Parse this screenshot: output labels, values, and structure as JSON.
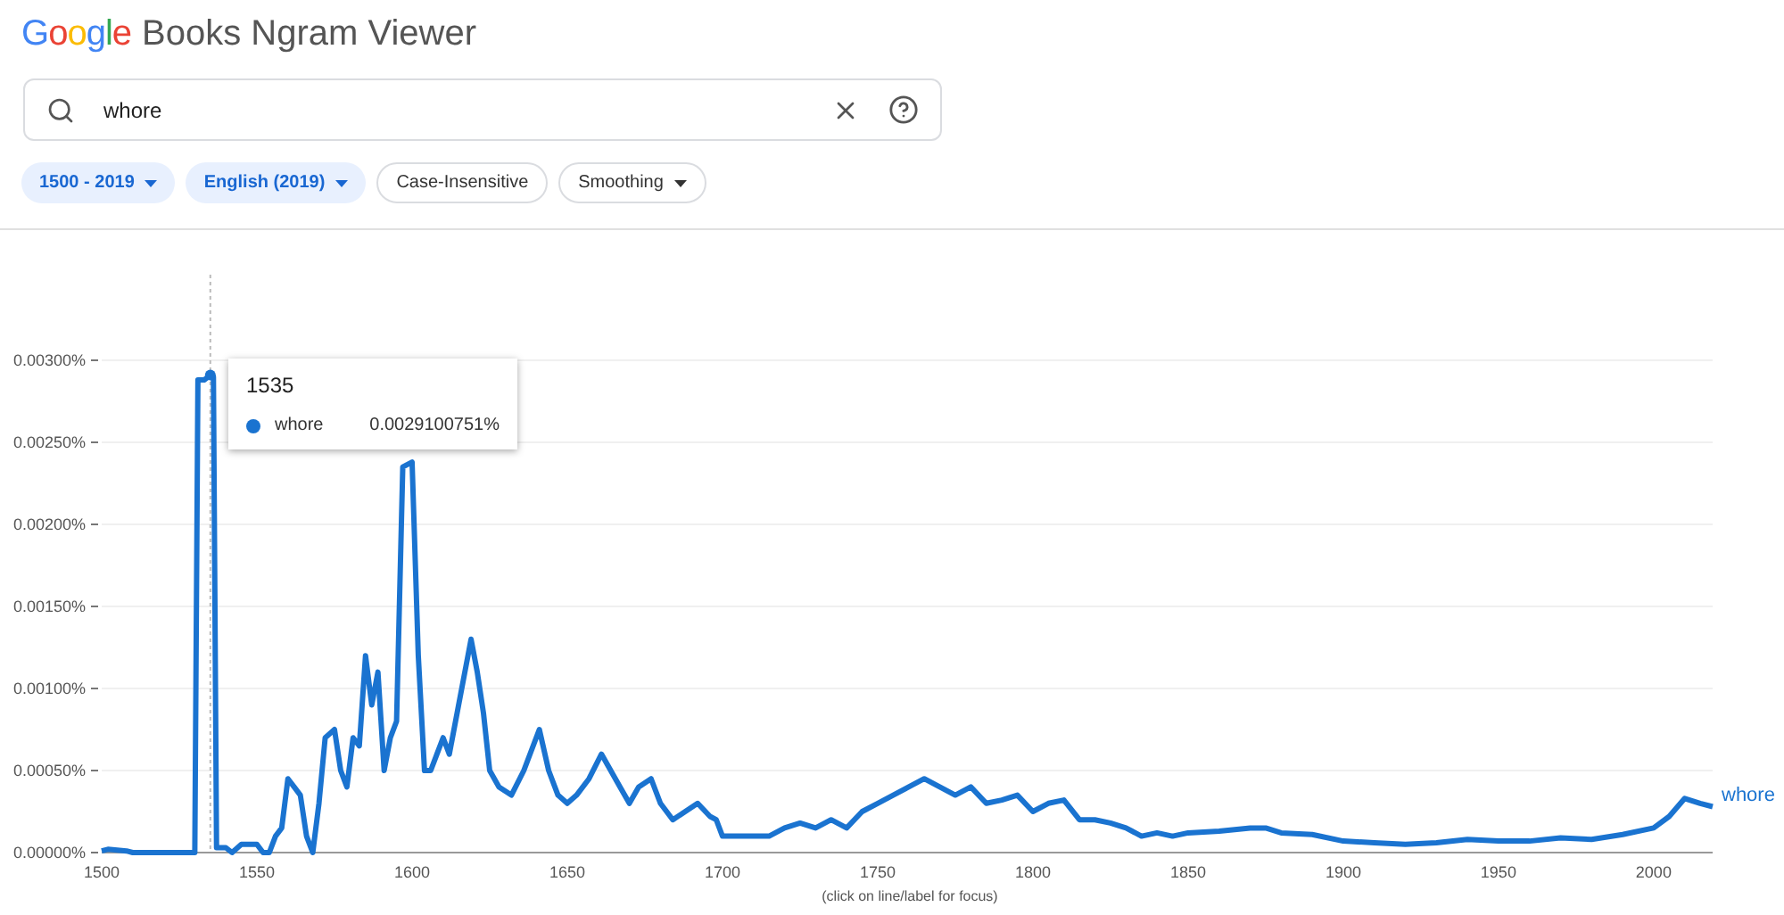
{
  "header": {
    "logo": "Google",
    "title": "Books Ngram Viewer"
  },
  "search": {
    "value": "whore"
  },
  "chips": [
    {
      "label": "1500 - 2019",
      "selected": true,
      "dropdown": true
    },
    {
      "label": "English (2019)",
      "selected": true,
      "dropdown": true
    },
    {
      "label": "Case-Insensitive",
      "selected": false,
      "dropdown": false
    },
    {
      "label": "Smoothing",
      "selected": false,
      "dropdown": true
    }
  ],
  "chart": {
    "tooltip": {
      "year": "1535",
      "series": "whore",
      "value": "0.0029100751%"
    },
    "caption": "(click on line/label for focus)",
    "chart_data": {
      "type": "line",
      "grid": true,
      "ref_lines": [
        {
          "axis": "x",
          "value": 1535
        }
      ],
      "xlim": [
        1500,
        2019
      ],
      "ylim": [
        0,
        0.0035
      ],
      "xticks": [
        1500,
        1550,
        1600,
        1650,
        1700,
        1750,
        1800,
        1850,
        1900,
        1950,
        2000
      ],
      "yticks": [
        {
          "value": 0,
          "label": "0.00000%"
        },
        {
          "value": 0.0005,
          "label": "0.00050%"
        },
        {
          "value": 0.001,
          "label": "0.00100%"
        },
        {
          "value": 0.0015,
          "label": "0.00150%"
        },
        {
          "value": 0.002,
          "label": "0.00200%"
        },
        {
          "value": 0.0025,
          "label": "0.00250%"
        },
        {
          "value": 0.003,
          "label": "0.00300%"
        }
      ],
      "x": [
        1500,
        1502,
        1508,
        1510,
        1530,
        1531,
        1533,
        1535,
        1536,
        1537,
        1540,
        1542,
        1545,
        1550,
        1552,
        1554,
        1556,
        1558,
        1560,
        1562,
        1564,
        1566,
        1568,
        1570,
        1572,
        1575,
        1577,
        1579,
        1581,
        1583,
        1585,
        1587,
        1589,
        1591,
        1593,
        1595,
        1597,
        1600,
        1602,
        1604,
        1606,
        1608,
        1610,
        1612,
        1615,
        1618,
        1619,
        1621,
        1623,
        1625,
        1628,
        1632,
        1636,
        1641,
        1644,
        1647,
        1650,
        1653,
        1657,
        1661,
        1664,
        1667,
        1670,
        1673,
        1677,
        1680,
        1684,
        1688,
        1692,
        1696,
        1698,
        1700,
        1705,
        1710,
        1715,
        1720,
        1725,
        1730,
        1735,
        1740,
        1745,
        1750,
        1755,
        1760,
        1765,
        1770,
        1775,
        1780,
        1785,
        1790,
        1795,
        1800,
        1805,
        1810,
        1815,
        1820,
        1825,
        1830,
        1835,
        1840,
        1845,
        1850,
        1860,
        1870,
        1875,
        1880,
        1890,
        1900,
        1910,
        1920,
        1930,
        1940,
        1950,
        1960,
        1970,
        1980,
        1990,
        2000,
        2005,
        2010,
        2015,
        2019
      ],
      "series": [
        {
          "name": "whore",
          "color": "#1a73d0",
          "values": [
            1e-05,
            2e-05,
            1e-05,
            0,
            0,
            0.00288,
            0.00288,
            0.00291,
            0.0029,
            3e-05,
            3e-05,
            0,
            5e-05,
            5e-05,
            0,
            0,
            0.0001,
            0.00015,
            0.00045,
            0.0004,
            0.00035,
            0.0001,
            0,
            0.0003,
            0.0007,
            0.00075,
            0.0005,
            0.0004,
            0.0007,
            0.00065,
            0.0012,
            0.0009,
            0.0011,
            0.0005,
            0.0007,
            0.0008,
            0.00235,
            0.00238,
            0.0012,
            0.0005,
            0.0005,
            0.0006,
            0.0007,
            0.0006,
            0.0009,
            0.0012,
            0.0013,
            0.0011,
            0.00085,
            0.0005,
            0.0004,
            0.00035,
            0.0005,
            0.00075,
            0.0005,
            0.00035,
            0.0003,
            0.00035,
            0.00045,
            0.0006,
            0.0005,
            0.0004,
            0.0003,
            0.0004,
            0.00045,
            0.0003,
            0.0002,
            0.00025,
            0.0003,
            0.00022,
            0.0002,
            0.0001,
            0.0001,
            0.0001,
            0.0001,
            0.00015,
            0.00018,
            0.00015,
            0.0002,
            0.00015,
            0.00025,
            0.0003,
            0.00035,
            0.0004,
            0.00045,
            0.0004,
            0.00035,
            0.0004,
            0.0003,
            0.00032,
            0.00035,
            0.00025,
            0.0003,
            0.00032,
            0.0002,
            0.0002,
            0.00018,
            0.00015,
            0.0001,
            0.00012,
            0.0001,
            0.00012,
            0.00013,
            0.00015,
            0.00015,
            0.00012,
            0.00011,
            7e-05,
            6e-05,
            5e-05,
            6e-05,
            8e-05,
            7e-05,
            7e-05,
            9e-05,
            8e-05,
            0.00011,
            0.00015,
            0.00022,
            0.00033,
            0.0003,
            0.00028
          ]
        }
      ]
    }
  }
}
